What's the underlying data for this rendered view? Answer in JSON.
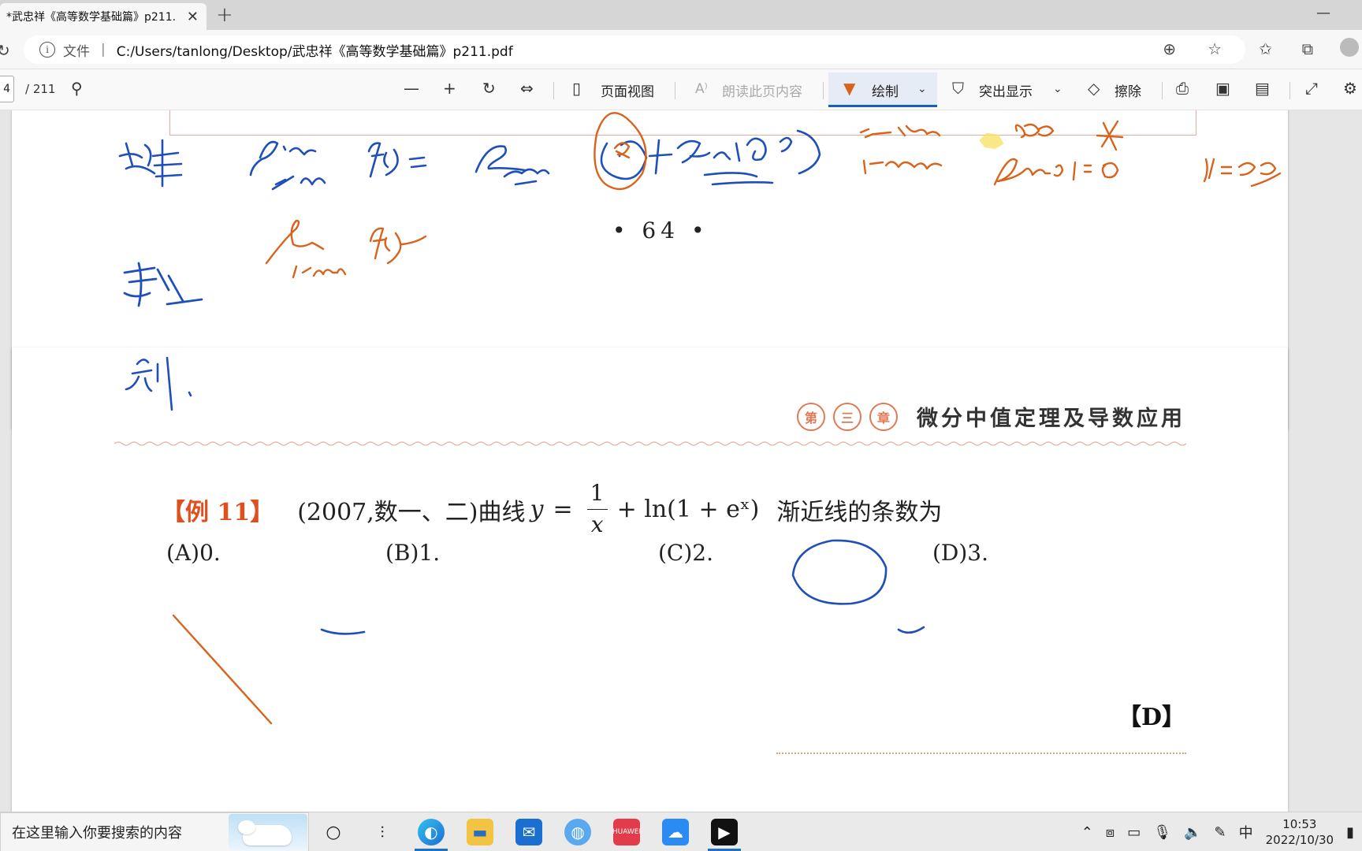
{
  "browser": {
    "tab_title": "*武忠祥《高等数学基础篇》p211.pdf",
    "tab_close": "✕",
    "new_tab": "+",
    "minimize": "—",
    "address": {
      "info_glyph": "i",
      "file_label": "文件",
      "separator": "|",
      "url": "C:/Users/tanlong/Desktop/武忠祥《高等数学基础篇》p211.pdf"
    }
  },
  "pdf_toolbar": {
    "page_current": "4",
    "page_total": "/ 211",
    "page_view": "页面视图",
    "read_aloud": "朗读此页内容",
    "draw": "绘制",
    "highlight": "突出显示",
    "erase": "擦除"
  },
  "page1": {
    "page_number": "• 64 •"
  },
  "page2": {
    "chapter_seals": [
      "第",
      "三",
      "章"
    ],
    "chapter_title": "微分中值定理及导数应用",
    "example_tag": "【例 11】",
    "example_source": "(2007,数一、二)曲线",
    "y_var": "y",
    "equals": "=",
    "frac_num": "1",
    "frac_den": "x",
    "expr_rest": "+ ln(1 + eˣ)",
    "question_tail": "渐近线的条数为",
    "options": [
      "(A)0.",
      "(B)1.",
      "(C)2.",
      "(D)3."
    ],
    "answer": "【D】"
  },
  "taskbar": {
    "search_placeholder": "在这里输入你要搜索的内容",
    "ime": "中",
    "time": "10:53",
    "date": "2022/10/30"
  },
  "colors": {
    "ink_blue": "#1f4fb8",
    "ink_orange": "#d8631c",
    "example_red": "#e0501e",
    "draw_accent": "#1a5fb4"
  }
}
